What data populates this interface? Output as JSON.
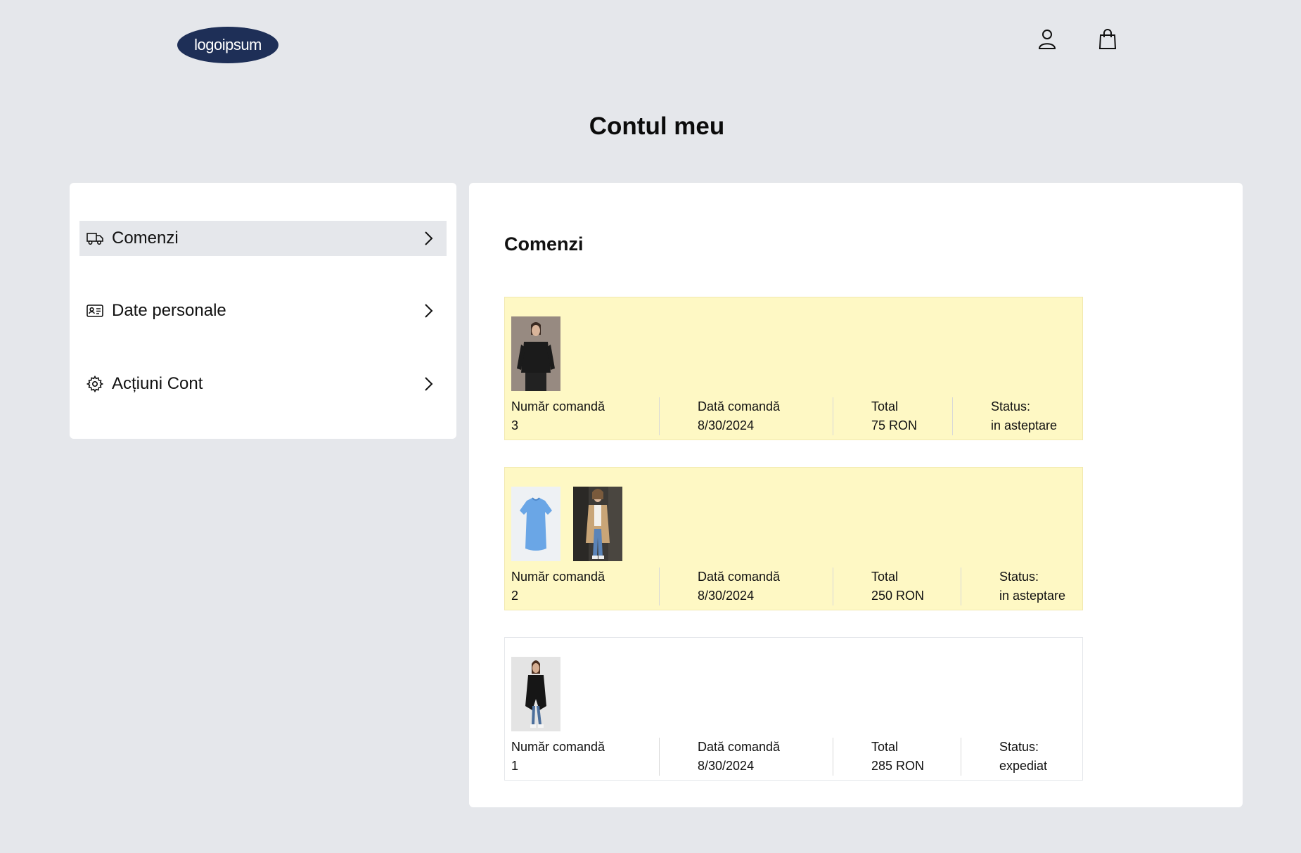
{
  "header": {
    "logo_text": "logoipsum",
    "icons": [
      "user-icon",
      "shopping-bag-icon"
    ]
  },
  "page_title": "Contul meu",
  "sidebar": {
    "items": [
      {
        "label": "Comenzi",
        "icon": "truck-icon",
        "active": true
      },
      {
        "label": "Date personale",
        "icon": "id-card-icon",
        "active": false
      },
      {
        "label": "Acțiuni Cont",
        "icon": "gear-icon",
        "active": false
      }
    ]
  },
  "main": {
    "title": "Comenzi",
    "field_labels": {
      "number": "Număr comandă",
      "date": "Dată comandă",
      "total": "Total",
      "status": "Status:"
    },
    "orders": [
      {
        "number": "3",
        "date": "8/30/2024",
        "total": "75 RON",
        "status": "in asteptare",
        "images": [
          "black-blouse-photo"
        ]
      },
      {
        "number": "2",
        "date": "8/30/2024",
        "total": "250 RON",
        "status": "in asteptare",
        "images": [
          "blue-tshirt-photo",
          "trench-coat-photo"
        ]
      },
      {
        "number": "1",
        "date": "8/30/2024",
        "total": "285 RON",
        "status": "expediat",
        "images": [
          "black-coat-photo"
        ]
      }
    ]
  },
  "colors": {
    "background": "#e5e7eb",
    "logo": "#1e2f57",
    "pending_order": "#fef8c4",
    "card": "#ffffff"
  }
}
